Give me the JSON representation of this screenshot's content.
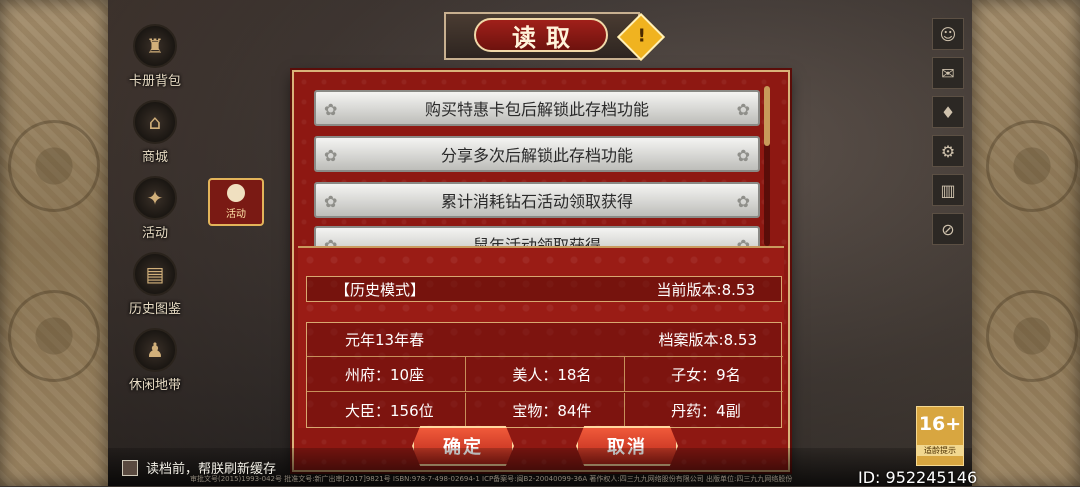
{
  "title": "读取",
  "left_menu": [
    {
      "icon": "card-pack-icon",
      "label": "卡册背包"
    },
    {
      "icon": "shop-icon",
      "label": "商城"
    },
    {
      "icon": "event-icon",
      "label": "活动"
    },
    {
      "icon": "history-book-icon",
      "label": "历史图鉴"
    },
    {
      "icon": "leisure-icon",
      "label": "休闲地带"
    }
  ],
  "event_tab_label": "活动",
  "right_icons": [
    "user-icon",
    "mail-icon",
    "notice-icon",
    "settings-gear-icon",
    "gift-icon",
    "hide-icon"
  ],
  "save_slots": [
    {
      "label": "购买特惠卡包后解锁此存档功能"
    },
    {
      "label": "分享多次后解锁此存档功能"
    },
    {
      "label": "累计消耗钻石活动领取获得"
    },
    {
      "label": "鼠年活动领取获得"
    }
  ],
  "info": {
    "mode": "【历史模式】",
    "current_version": "当前版本:8.53",
    "date": "元年13年春",
    "save_version": "档案版本:8.53",
    "stats": [
      [
        "州府：10座",
        "美人：18名",
        "子女：9名"
      ],
      [
        "大臣：156位",
        "宝物：84件",
        "丹药：4副"
      ]
    ]
  },
  "buttons": {
    "confirm": "确定",
    "cancel": "取消"
  },
  "refresh_label": "读档前，帮朕刷新缓存",
  "fine_print": "审批文号(2015)1993-042号  批准文号:新广出审[2017]9821号  ISBN:978-7-498-02694-1  ICP备案号:闽B2-20040099-36A  著作权人:四三九九网络股份有限公司  出版单位:四三九九网络股份",
  "age_badge": {
    "rating": "16+",
    "label": "适龄提示"
  },
  "user_id": "ID: 952245146",
  "colors": {
    "dialog_red": "#8e1812",
    "gold": "#d9b27a",
    "button_red": "#e04a30"
  }
}
